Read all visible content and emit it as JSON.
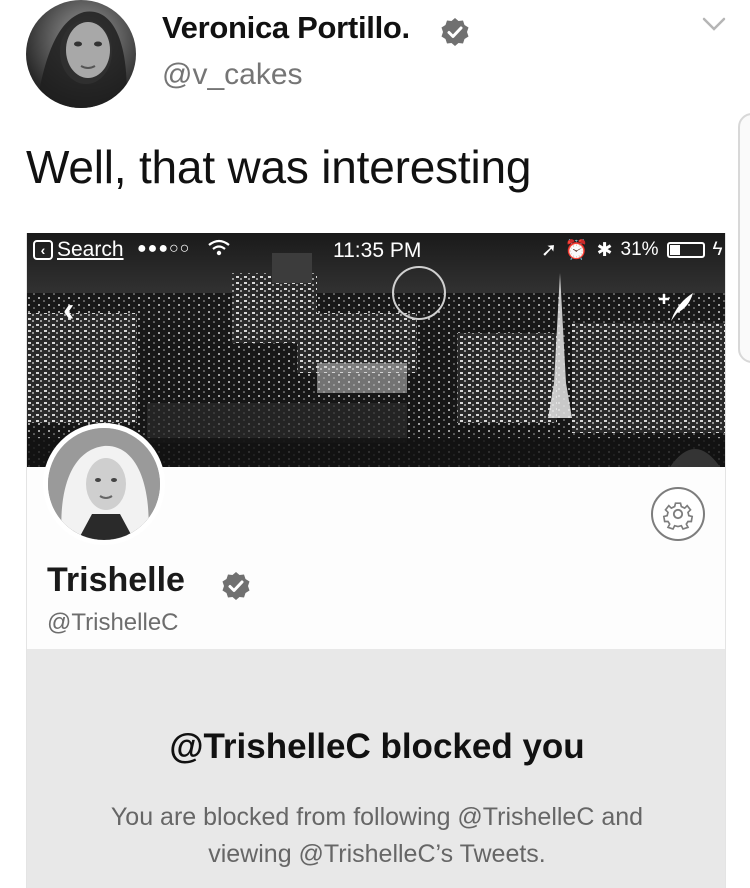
{
  "tweet": {
    "author_name": "Veronica Portillo.",
    "author_handle": "@v_cakes",
    "text": "Well, that was interesting",
    "icons": {
      "verified": "verified-badge-icon",
      "more": "chevron-down-icon"
    }
  },
  "embedded_screenshot": {
    "status_bar": {
      "back_app_label": "Search",
      "signal": "●●●○○",
      "time": "11:35 PM",
      "battery_percent": "31%",
      "battery_level": 0.31
    },
    "profile": {
      "name": "Trishelle",
      "handle": "@TrishelleC",
      "icons": {
        "back": "chevron-left-icon",
        "compose": "compose-tweet-icon",
        "settings": "gear-icon",
        "verified": "verified-badge-icon"
      }
    },
    "blocked": {
      "title": "@TrishelleC blocked you",
      "message": "You are blocked from following @TrishelleC and viewing @TrishelleC’s Tweets."
    }
  },
  "colors": {
    "badge": "#707070",
    "handle_gray": "#757575",
    "panel_bg": "#e8e8e8"
  }
}
